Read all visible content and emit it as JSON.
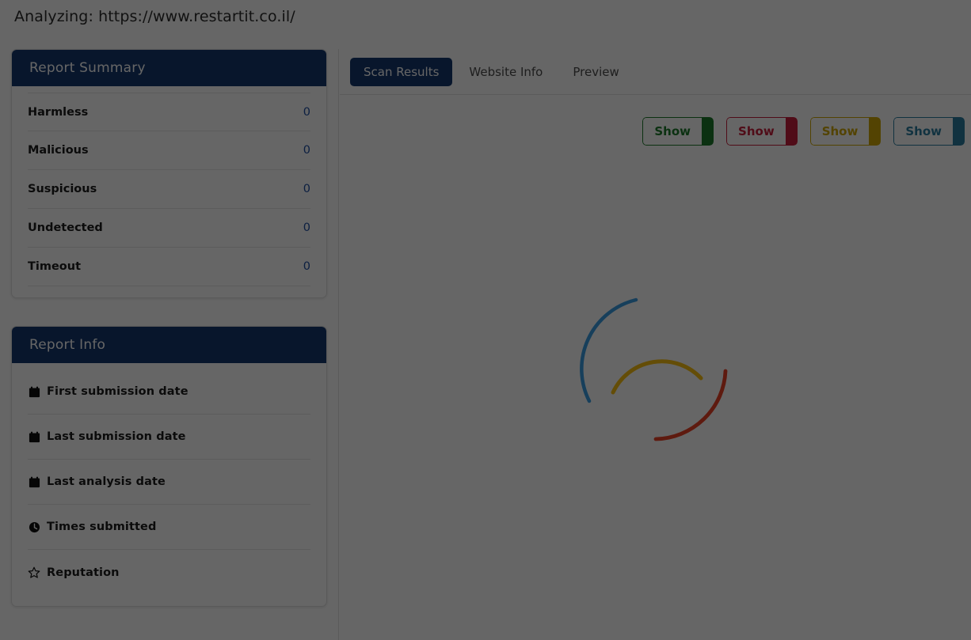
{
  "header": {
    "analyzing_label": "Analyzing: https://www.restartit.co.il/"
  },
  "sidebar": {
    "summary_card": {
      "title": "Report Summary",
      "rows": [
        {
          "label": "Harmless",
          "value": "0"
        },
        {
          "label": "Malicious",
          "value": "0"
        },
        {
          "label": "Suspicious",
          "value": "0"
        },
        {
          "label": "Undetected",
          "value": "0"
        },
        {
          "label": "Timeout",
          "value": "0"
        }
      ]
    },
    "info_card": {
      "title": "Report Info",
      "rows": [
        {
          "label": "First submission date",
          "icon": "calendar-icon"
        },
        {
          "label": "Last submission date",
          "icon": "calendar-icon"
        },
        {
          "label": "Last analysis date",
          "icon": "calendar-icon"
        },
        {
          "label": "Times submitted",
          "icon": "clock-icon"
        },
        {
          "label": "Reputation",
          "icon": "star-icon"
        }
      ]
    }
  },
  "main": {
    "tabs": [
      {
        "label": "Scan Results",
        "active": true
      },
      {
        "label": "Website Info",
        "active": false
      },
      {
        "label": "Preview",
        "active": false
      }
    ],
    "show_buttons": [
      {
        "label": "Show",
        "color": "#1d7a2c"
      },
      {
        "label": "Show",
        "color": "#c8203c"
      },
      {
        "label": "Show",
        "color": "#cfa707"
      },
      {
        "label": "Show",
        "color": "#2c7ea1"
      }
    ],
    "spinner": {
      "name": "loading-spinner",
      "arcs": [
        {
          "color": "#3b9de4",
          "name": "spinner-arc-blue"
        },
        {
          "color": "#f9c113",
          "name": "spinner-arc-yellow"
        },
        {
          "color": "#ea4126",
          "name": "spinner-arc-red"
        }
      ]
    }
  },
  "theme": {
    "header_blue": "#16386e",
    "value_blue": "#1e4fa3",
    "page_bg": "#ffffff",
    "overlay": "rgba(0,0,0,0.60)"
  }
}
